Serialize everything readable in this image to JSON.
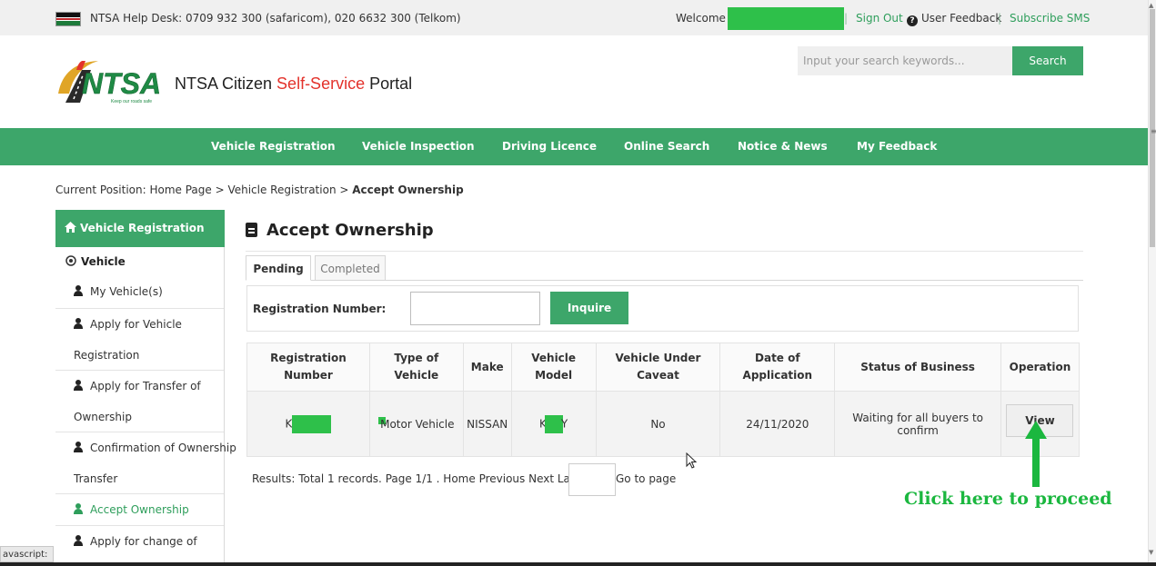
{
  "topbar": {
    "helpdesk": "NTSA Help Desk: 0709 932 300 (safaricom), 020 6632 300 (Telkom)",
    "welcome": "Welcome",
    "separator": "|",
    "signout": "Sign Out",
    "user_feedback": "User Feedback",
    "subscribe": "Subscribe SMS"
  },
  "header": {
    "logo_text": "NTSA",
    "logo_tagline": "Keep our roads safe",
    "title_part1": "NTSA Citizen ",
    "title_part2": "Self-Service",
    "title_part3": " Portal",
    "search_placeholder": "Input your search keywords...",
    "search_label": "Search"
  },
  "nav": {
    "items": [
      "Vehicle Registration",
      "Vehicle Inspection",
      "Driving Licence",
      "Online Search",
      "Notice & News",
      "My Feedback"
    ]
  },
  "breadcrumb": {
    "prefix": "Current Position: Home Page > Vehicle Registration > ",
    "current": "Accept Ownership"
  },
  "sidebar": {
    "header": "Vehicle Registration",
    "sub": "Vehicle",
    "items": [
      {
        "l1": "My Vehicle(s)"
      },
      {
        "l1": "Apply for Vehicle",
        "l2": "Registration"
      },
      {
        "l1": "Apply for Transfer of",
        "l2": "Ownership"
      },
      {
        "l1": "Confirmation of Ownership",
        "l2": "Transfer"
      },
      {
        "l1": "Accept Ownership"
      },
      {
        "l1": "Apply for change of"
      }
    ]
  },
  "main": {
    "title": "Accept Ownership",
    "tabs": [
      "Pending",
      "Completed"
    ],
    "reg_label": "Registration Number:",
    "inquire_label": "Inquire",
    "table": {
      "headers": [
        [
          "Registration",
          "Number"
        ],
        [
          "Type of",
          "Vehicle"
        ],
        [
          "Make"
        ],
        [
          "Vehicle",
          "Model"
        ],
        [
          "Vehicle Under",
          "Caveat"
        ],
        [
          "Date of",
          "Application"
        ],
        [
          "Status of Business"
        ],
        [
          "Operation"
        ]
      ],
      "row": {
        "reg_prefix": "K",
        "type": "Motor Vehicle",
        "make": "NISSAN",
        "model_prefix": "K",
        "model_suffix": "Y",
        "caveat": "No",
        "date": "24/11/2020",
        "status": "Waiting for all buyers to confirm",
        "operation": "View"
      }
    },
    "results": "Results: Total 1 records. Page 1/1 .  Home Previous Next Last",
    "goto": "Go to page"
  },
  "annotation": {
    "text": "Click here to proceed",
    "color": "#1bb73f"
  },
  "statusbar": "avascript:",
  "colors": {
    "brand_green": "#3da66a",
    "accent_red": "#e3322b",
    "mask_green": "#2ec04a"
  }
}
